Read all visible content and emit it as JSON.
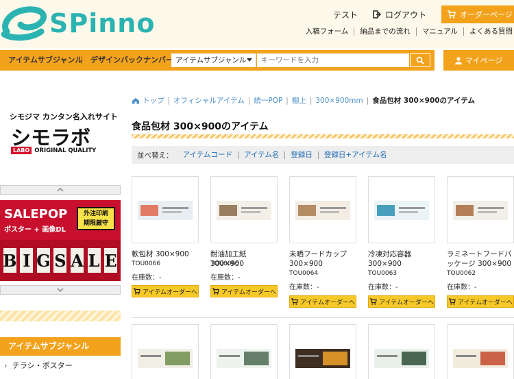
{
  "header": {
    "logo_text": "SPinno",
    "user_name": "テスト",
    "logout_label": "ログアウト",
    "order_page_label": "オーダーページ",
    "sub_links": [
      "入稿フォーム",
      "納品までの流れ",
      "マニュアル",
      "よくある質問"
    ]
  },
  "navbar": {
    "item_genre": "アイテムサブジャンル",
    "item_backnumber": "デザインバックナンバー",
    "select_value": "アイテムサブジャンル",
    "search_placeholder": "キーワードを入力",
    "mypage_label": "マイページ"
  },
  "sidebar": {
    "shimo_title": "シモジマ カンタン名入れサイト",
    "shimo_logo": "シモラボ",
    "labo_tag": "LABO",
    "quality_text": "ORIGINAL QUALITY",
    "banner": {
      "salepop": "SALEPOP",
      "sub": "ポスター + 画像DL",
      "badge_line1": "外注印刷",
      "badge_line2": "期限厳守",
      "bigsale": [
        "B",
        "I",
        "G",
        "S",
        "A",
        "L",
        "E"
      ]
    },
    "genre_header": "アイテムサブジャンル",
    "genre_items": [
      "チラシ・ポスター"
    ]
  },
  "breadcrumb": {
    "home": "トップ",
    "items": [
      "オフィシャルアイテム",
      "統一POP",
      "棚上",
      "300×900mm"
    ],
    "current": "食品包材 300×900のアイテム"
  },
  "page_title": "食品包材 300×900のアイテム",
  "sort": {
    "label": "並べ替え：",
    "options": [
      "アイテムコード",
      "アイテム名",
      "登録日",
      "登録日+アイテム名"
    ]
  },
  "stock_label": "在庫数：",
  "stock_value": "-",
  "order_button_label": "アイテムオーダーへ",
  "products": [
    {
      "name": "軟包材 300×900",
      "code": "TOU0066",
      "art_color": "#e9eef2",
      "accent": "#e0664c"
    },
    {
      "name": "耐油加工紙 300×900",
      "code": "TOU0065",
      "art_color": "#f4efe6",
      "accent": "#8a6a48"
    },
    {
      "name": "未晒フードカップ 300×900",
      "code": "TOU0064",
      "art_color": "#f3ede4",
      "accent": "#a87b4e"
    },
    {
      "name": "冷凍対応容器 300×900",
      "code": "TOU0063",
      "art_color": "#eaf4f6",
      "accent": "#2a8fb0"
    },
    {
      "name": "ラミネートフードパッケージ 300×900",
      "code": "TOU0062",
      "art_color": "#f2efe8",
      "accent": "#a86a3e"
    }
  ],
  "products_row2": [
    {
      "art_color": "#f1eee6",
      "accent": "#6e8d4a"
    },
    {
      "art_color": "#eef3ee",
      "accent": "#4c6a52"
    },
    {
      "art_color": "#3f2e22",
      "accent": "#f1a22a"
    },
    {
      "art_color": "#e9f0ea",
      "accent": "#2e4d38"
    },
    {
      "art_color": "#f2ecdf",
      "accent": "#c24a2d"
    }
  ],
  "colors": {
    "brand_teal": "#2bb3b2",
    "accent_orange": "#f3a21b",
    "button_yellow": "#f7c928",
    "link_blue": "#1b6ab5"
  }
}
